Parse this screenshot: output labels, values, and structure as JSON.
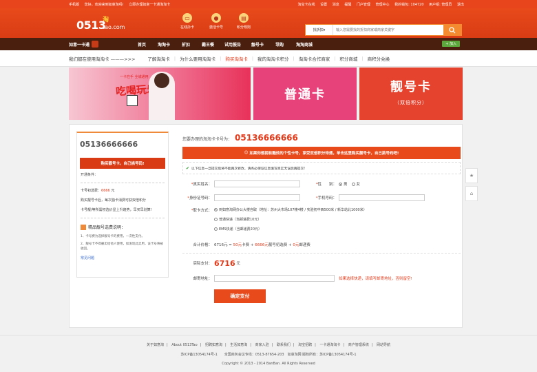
{
  "topbar": {
    "left": [
      "手机版",
      "您好，欢迎来到如意淘吗!",
      "立即办理如意一卡通淘淘卡"
    ],
    "right": [
      "淘宝卡在线",
      "设置",
      "消息",
      "提醒",
      "门户管理",
      "管理中心",
      "我的钱包: 104720",
      "用户组: 管理员",
      "退出"
    ]
  },
  "logo": {
    "num": "0513",
    "tao": "tao.com",
    "han": "淘"
  },
  "header_nav": [
    {
      "label": "在线办卡",
      "icon": "card-icon"
    },
    {
      "label": "激活卡号",
      "icon": "activate-icon"
    },
    {
      "label": "积分规则",
      "icon": "rules-icon"
    }
  ],
  "search": {
    "category": "找折扣",
    "placeholder": "输入您需要找的折扣商家或商家关键字"
  },
  "mainnav": {
    "brand": "如意一卡通",
    "items": [
      "首页",
      "淘淘卡",
      "折扣",
      "霸王餐",
      "试用报告",
      "靓号卡",
      "导购",
      "淘淘商城"
    ],
    "join": "+ 加入"
  },
  "subnav": {
    "intro": "我们都在使用淘淘卡 ———>>>",
    "items": [
      "了解淘淘卡",
      "为什么要用淘淘卡",
      "购买淘淘卡",
      "我的淘淘卡积分",
      "淘淘卡合作商家",
      "积分商城",
      "商积分兑换"
    ],
    "active_index": 2
  },
  "banners": {
    "ban1": {
      "sub": "一卡在手 全城通用",
      "title": "吃喝玩乐"
    },
    "ban2": "普通卡",
    "ban3": {
      "title": "靓号卡",
      "sub": "（双倍积分）"
    }
  },
  "sidebar": {
    "number": "05136666666",
    "buy_label": "购买靓号卡，自己挑号码!",
    "cond_title": "开通条件：",
    "price_label": "卡号初选费：",
    "price_value": "6666",
    "price_unit": "元",
    "line2": "购买靓号卡后，每次独卡消费可获双倍积分",
    "line3": "卡号靓/等所需初选价显上升趋势，早买早划算!",
    "sect_title": "精品靓号选费说明：",
    "notes": [
      "1、卡号费为选择靓号卡的费用，一次性支付。",
      "2、靓号卡不得删卖给他人使用，如发现此卖用，该卡号将被收回。"
    ],
    "link": "常见问题"
  },
  "form": {
    "title_label": "您要办理的淘淘卡卡号为：",
    "title_number": "05136666666",
    "promo": "如果你想拥有酷炫的个性卡号，享受双倍积分待遇，单击这里购买靓号卡，自己挑号码吧!",
    "note": "以下信息一旦提交后将不能再次修改，请务必保证信息填写真实无误后再提交!",
    "name_label": "真实姓名：",
    "gender_label": "性　　别：",
    "gender_options": [
      "男",
      "女"
    ],
    "id_label": "身份证号码：",
    "phone_label": "手机号码：",
    "delivery_label": "取卡方式：",
    "delivery_options": [
      "到如意淘网办公大楼自取（地址：苏州大市场107幢4楼 / 实验初中西500米 / 新华站北1000米）",
      "普通快递（当邮递费10元）",
      "EMS快递（当邮递费20元）"
    ],
    "total_label": "合计价格：",
    "total_text": "6716元 = 50元卡费 + 6666元靓号初选费 + 0元邮递费",
    "total_parts": [
      "6716元",
      "50元",
      "6666元",
      "0元"
    ],
    "pay_label": "实际支付：",
    "pay_value": "6716",
    "pay_unit": "元",
    "addr_label": "邮寄地址：",
    "addr_note": "如果选择快递，请填写邮寄地址，否则留空!",
    "submit_label": "确定支付"
  },
  "floatbar": [
    "★",
    "⌂"
  ],
  "footer": {
    "links": [
      "关于如意淘",
      "About 0513Tao",
      "招聘如意淘",
      "生活如意淘",
      "商家入驻",
      "联系我们",
      "淘宝招聘",
      "一卡通淘淘卡",
      "商户管理系统",
      "网站导航"
    ],
    "line2": "苏ICP备13054174号-1　　全国商务会议专线：0513-87654-203　如意淘网 版权所有：苏ICP备13054174号-1",
    "line3": "Copyright © 2013 - 2014 BanBan. All Rights Reserved"
  }
}
